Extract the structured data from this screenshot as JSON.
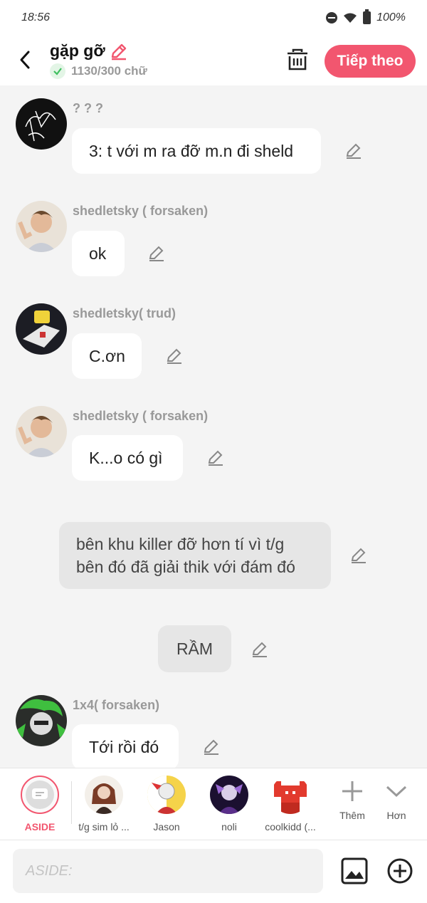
{
  "status": {
    "time": "18:56",
    "battery": "100%"
  },
  "header": {
    "title": "gặp gỡ",
    "char_count": "1130/300 chữ",
    "next_label": "Tiếp theo"
  },
  "messages": [
    {
      "sender": "? ? ?",
      "text": "3: t với m ra đỡ m.n đi sheld"
    },
    {
      "sender": "shedletsky ( forsaken)",
      "text": "ok"
    },
    {
      "sender": "shedletsky( trud)",
      "text": "C.ơn"
    },
    {
      "sender": "shedletsky ( forsaken)",
      "text": "K...o có gì"
    },
    {
      "sender": "",
      "text": "bên khu killer đỡ hơn tí vì t/g bên đó đã giải thik với đám đó"
    },
    {
      "sender": "",
      "text": "RẦM"
    },
    {
      "sender": "1x4( forsaken)",
      "text": "Tới rồi đó"
    }
  ],
  "characters": [
    {
      "name": "ASIDE",
      "icon": "aside-icon",
      "selected": true
    },
    {
      "name": "t/g sim lỏ ...",
      "icon": "avatar-tg-sim"
    },
    {
      "name": "Jason",
      "icon": "avatar-jason"
    },
    {
      "name": "noli",
      "icon": "avatar-noli"
    },
    {
      "name": "coolkidd (...",
      "icon": "avatar-coolkidd"
    },
    {
      "name": "Thêm",
      "icon": "plus-icon"
    },
    {
      "name": "Hơn",
      "icon": "chevron-down-icon"
    }
  ],
  "input": {
    "placeholder": "ASIDE:"
  },
  "colors": {
    "accent": "#f2566f",
    "check": "#3fbf5f"
  }
}
